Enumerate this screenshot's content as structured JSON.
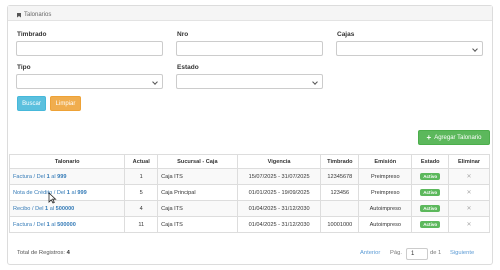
{
  "panel": {
    "title": "Talonarios"
  },
  "filters": {
    "timbrado_label": "Timbrado",
    "nro_label": "Nro",
    "cajas_label": "Cajas",
    "tipo_label": "Tipo",
    "estado_label": "Estado"
  },
  "buttons": {
    "search": "Buscar",
    "clear": "Limpiar",
    "add": "Agregar Talonario"
  },
  "table": {
    "headers": [
      "Talonario",
      "Actual",
      "Sucursal - Caja",
      "Vigencia",
      "Timbrado",
      "Emisión",
      "Estado",
      "Eliminar"
    ],
    "rows": [
      {
        "tal_prefix": "Factura / Del ",
        "tal_from": "1",
        "tal_mid": " al ",
        "tal_to": "999",
        "actual": "1",
        "sucursal": "Caja ITS",
        "vigencia": "15/07/2025 - 31/07/2025",
        "timbrado": "12345678",
        "emision": "Preimpreso",
        "estado": "Activo"
      },
      {
        "tal_prefix": "Nota de Crédito / Del ",
        "tal_from": "1",
        "tal_mid": " al ",
        "tal_to": "999",
        "actual": "5",
        "sucursal": "Caja Principal",
        "vigencia": "01/01/2025 - 19/09/2025",
        "timbrado": "123456",
        "emision": "Preimpreso",
        "estado": "Activo"
      },
      {
        "tal_prefix": "Recibo / Del ",
        "tal_from": "1",
        "tal_mid": " al ",
        "tal_to": "500000",
        "actual": "4",
        "sucursal": "Caja ITS",
        "vigencia": "01/04/2025 - 31/12/2030",
        "timbrado": "",
        "emision": "Autoimpreso",
        "estado": "Activo"
      },
      {
        "tal_prefix": "Factura / Del ",
        "tal_from": "1",
        "tal_mid": " al ",
        "tal_to": "500000",
        "actual": "11",
        "sucursal": "Caja ITS",
        "vigencia": "01/04/2025 - 31/12/2030",
        "timbrado": "10001000",
        "emision": "Autoimpreso",
        "estado": "Activo"
      }
    ]
  },
  "footer": {
    "total_label": "Total de Registros:",
    "total_value": "4",
    "prev": "Anterior",
    "page_label": "Pág.",
    "page_value": "1",
    "of_label": "de 1",
    "next": "Siguiente"
  },
  "colors": {
    "primary": "#337ab7",
    "info": "#5bc0de",
    "warning": "#f0ad4e",
    "success": "#5cb85c"
  }
}
